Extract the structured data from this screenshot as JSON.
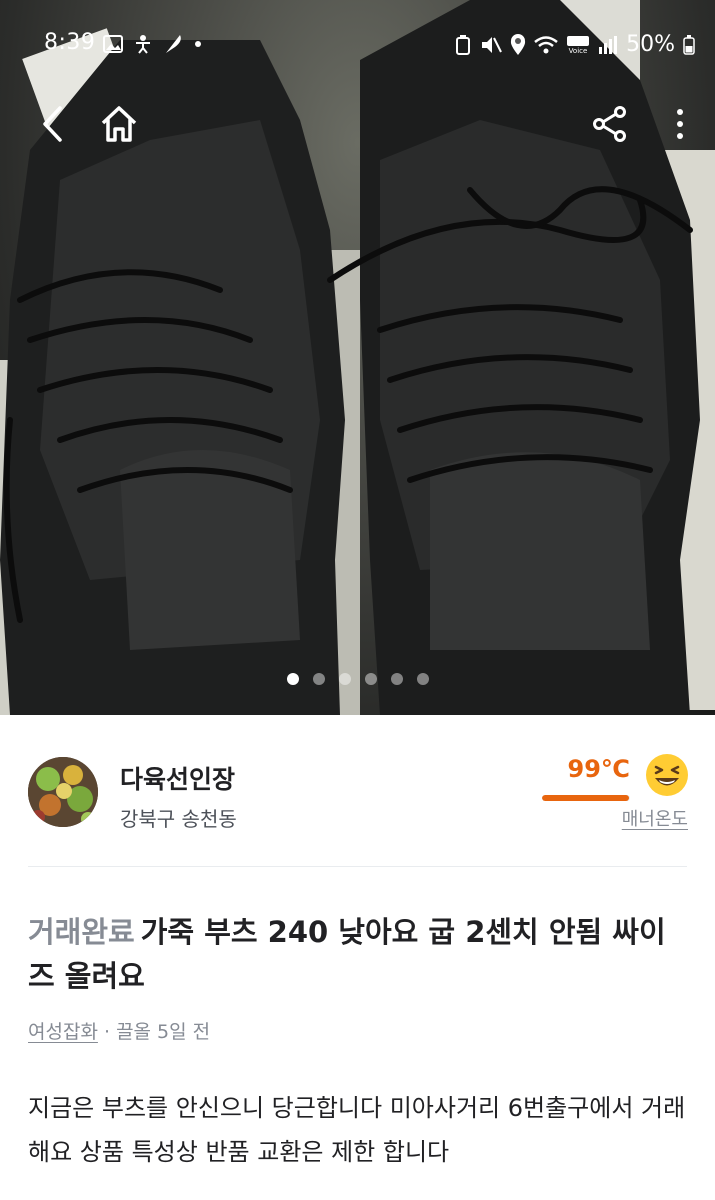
{
  "status_bar": {
    "time": "8:39",
    "battery": "50%",
    "left_icons": [
      "gallery-icon",
      "accessibility-icon",
      "feather-icon",
      "dot-icon"
    ],
    "right_icons": [
      "recycle-icon",
      "mute-icon",
      "location-icon",
      "wifi-icon",
      "hd-voice-icon",
      "signal-icon",
      "battery-icon"
    ]
  },
  "image_carousel": {
    "count": 6,
    "active_index": 0
  },
  "seller": {
    "nickname": "다육선인장",
    "location": "강북구 송천동",
    "manner_temp": "99℃",
    "manner_temp_value": 99,
    "manner_label": "매너온도",
    "temp_color": "#e8650e"
  },
  "post": {
    "status": "거래완료",
    "title": "가죽 부츠 240  낮아요 굽 2센치 안됨 싸이즈 올려요",
    "category": "여성잡화",
    "separator": "·",
    "time": "끌올 5일 전",
    "body": "지금은 부츠를 안신으니 당근합니다 미아사거리 6번출구에서 거래해요 상품 특성상 반품 교환은 제한 합니다"
  }
}
